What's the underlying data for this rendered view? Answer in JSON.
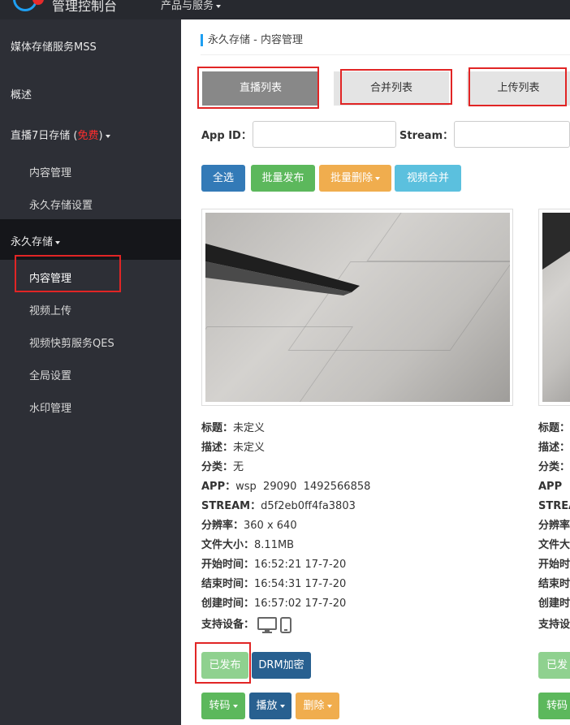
{
  "topbar": {
    "app_title": "管理控制台",
    "products_label": "产品与服务"
  },
  "sidebar": {
    "service_title": "媒体存储服务MSS",
    "overview": "概述",
    "live7": {
      "label": "直播7日存储",
      "free_label": "免费"
    },
    "live7_items": [
      "内容管理",
      "永久存储设置"
    ],
    "permanent": {
      "label": "永久存储"
    },
    "permanent_items": [
      "内容管理",
      "视频上传",
      "视频快剪服务QES",
      "全局设置",
      "水印管理"
    ]
  },
  "main": {
    "breadcrumb": "永久存储 - 内容管理",
    "tabs": [
      "直播列表",
      "合并列表",
      "上传列表"
    ],
    "filters": {
      "appid_label": "App ID：",
      "appid_value": "",
      "stream_label": "Stream：",
      "stream_value": ""
    },
    "actions": {
      "select_all": "全选",
      "batch_publish": "批量发布",
      "batch_delete": "批量删除",
      "merge": "视频合并"
    }
  },
  "cards": [
    {
      "title_k": "标题：",
      "title_v": "未定义",
      "desc_k": "描述：",
      "desc_v": "未定义",
      "cat_k": "分类：",
      "cat_v": "无",
      "app_k": "APP：",
      "app_v": "wsp  29090  1492566858",
      "stream_k": "STREAM：",
      "stream_v": "d5f2eb0ff4fa3803",
      "res_k": "分辨率：",
      "res_v": "360 x 640",
      "size_k": "文件大小：",
      "size_v": "8.11MB",
      "start_k": "开始时间：",
      "start_v": "16:52:21 17-7-20",
      "end_k": "结束时间：",
      "end_v": "16:54:31 17-7-20",
      "created_k": "创建时间：",
      "created_v": "16:57:02 17-7-20",
      "devices_k": "支持设备：",
      "published_label": "已发布",
      "drm_label": "DRM加密",
      "transcode_label": "转码",
      "play_label": "播放",
      "delete_label": "删除"
    },
    {
      "title_k": "标题：",
      "desc_k": "描述：",
      "cat_k": "分类：",
      "app_k": "APP",
      "stream_k": "STREA",
      "res_k": "分辨率",
      "size_k": "文件大",
      "start_k": "开始时",
      "end_k": "结束时",
      "created_k": "创建时",
      "devices_k": "支持设",
      "published_label": "已发",
      "transcode_label": "转码"
    }
  ],
  "colors": {
    "sidebar_bg": "#2d2f36",
    "sidebar_active": "#15161a",
    "highlight_red": "#e12525",
    "accent_blue": "#1e9ff2",
    "free_red": "#ff2d2d"
  }
}
